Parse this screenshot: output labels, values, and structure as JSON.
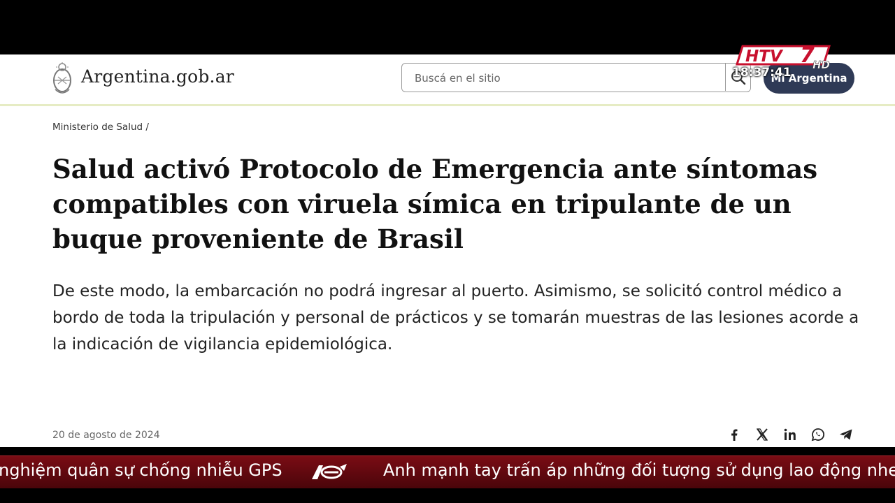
{
  "site": {
    "title": "Argentina.gob.ar",
    "search_placeholder": "Buscá en el sitio",
    "account_label": "Mi Argentina"
  },
  "article": {
    "breadcrumb": "Ministerio de Salud /",
    "headline": "Salud activó Protocolo de Emergencia ante síntomas compatibles con viruela símica en tripulante de un buque proveniente de Brasil",
    "lead": "De este modo, la embarcación no podrá ingresar al puerto. Asimismo, se solicitó control médico a bordo de toda la tripulación y personal de prácticos y se tomarán muestras de las lesiones acorde a la indicación de vigilancia epidemiológica.",
    "date": "20 de agosto de 2024",
    "share_icons": [
      "facebook-icon",
      "x-icon",
      "linkedin-icon",
      "whatsapp-icon",
      "telegram-icon"
    ]
  },
  "broadcast": {
    "channel_logo": "HTV7 HD",
    "clock": "18:37:41",
    "ticker_left": "nghiệm quân sự chống nhiễu GPS",
    "ticker_right": "Anh mạnh tay trấn áp những đối tượng sử dụng lao động nhe"
  },
  "colors": {
    "account_bg": "#2f3a56",
    "ticker_bg": "#7a0c14",
    "header_rule": "#e6ecc4"
  }
}
